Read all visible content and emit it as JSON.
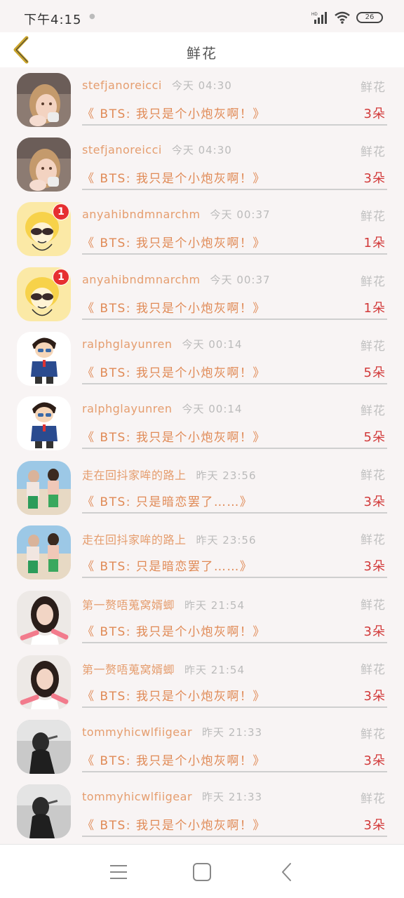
{
  "status_bar": {
    "time": "下午4:15",
    "battery": "26"
  },
  "header": {
    "title": "鲜花"
  },
  "items": [
    {
      "username": "stefjanoreicci",
      "time": "今天 04:30",
      "category": "鲜花",
      "book": "《 BTS: 我只是个小炮灰啊！》",
      "count": "3朵",
      "avatar": "girl-photo",
      "badge": ""
    },
    {
      "username": "stefjanoreicci",
      "time": "今天 04:30",
      "category": "鲜花",
      "book": "《 BTS: 我只是个小炮灰啊！》",
      "count": "3朵",
      "avatar": "girl-photo",
      "badge": ""
    },
    {
      "username": "anyahibndmnarchm",
      "time": "今天 00:37",
      "category": "鲜花",
      "book": "《 BTS: 我只是个小炮灰啊！》",
      "count": "1朵",
      "avatar": "cartoon-boy",
      "badge": "1"
    },
    {
      "username": "anyahibndmnarchm",
      "time": "今天 00:37",
      "category": "鲜花",
      "book": "《 BTS: 我只是个小炮灰啊！》",
      "count": "1朵",
      "avatar": "cartoon-boy",
      "badge": "1"
    },
    {
      "username": "ralphglayunren",
      "time": "今天 00:14",
      "category": "鲜花",
      "book": "《 BTS: 我只是个小炮灰啊！》",
      "count": "5朵",
      "avatar": "anime-detective",
      "badge": ""
    },
    {
      "username": "ralphglayunren",
      "time": "今天 00:14",
      "category": "鲜花",
      "book": "《 BTS: 我只是个小炮灰啊！》",
      "count": "5朵",
      "avatar": "anime-detective",
      "badge": ""
    },
    {
      "username": "走在回抖家哞的路上",
      "time": "昨天 23:56",
      "category": "鲜花",
      "book": "《 BTS: 只是暗恋罢了……》",
      "count": "3朵",
      "avatar": "beach-couple",
      "badge": ""
    },
    {
      "username": "走在回抖家哞的路上",
      "time": "昨天 23:56",
      "category": "鲜花",
      "book": "《 BTS: 只是暗恋罢了……》",
      "count": "3朵",
      "avatar": "beach-couple",
      "badge": ""
    },
    {
      "username": "第一赘唔蒐窝婿蝍",
      "time": "昨天 21:54",
      "category": "鲜花",
      "book": "《 BTS: 我只是个小炮灰啊！》",
      "count": "3朵",
      "avatar": "girl-pink",
      "badge": ""
    },
    {
      "username": "第一赘唔蒐窝婿蝍",
      "time": "昨天 21:54",
      "category": "鲜花",
      "book": "《 BTS: 我只是个小炮灰啊！》",
      "count": "3朵",
      "avatar": "girl-pink",
      "badge": ""
    },
    {
      "username": "tommyhicwlfiigear",
      "time": "昨天 21:33",
      "category": "鲜花",
      "book": "《 BTS: 我只是个小炮灰啊！》",
      "count": "3朵",
      "avatar": "bw-portrait",
      "badge": ""
    },
    {
      "username": "tommyhicwlfiigear",
      "time": "昨天 21:33",
      "category": "鲜花",
      "book": "《 BTS: 我只是个小炮灰啊！》",
      "count": "3朵",
      "avatar": "bw-portrait",
      "badge": ""
    }
  ],
  "nav": {
    "icons": [
      "menu-icon",
      "home-square-icon",
      "back-chevron-icon"
    ]
  },
  "colors": {
    "username": "#e59d6e",
    "book": "#e08a56",
    "count": "#d23a3a",
    "back_arrow": "#caa42a",
    "badge": "#e62f30"
  }
}
